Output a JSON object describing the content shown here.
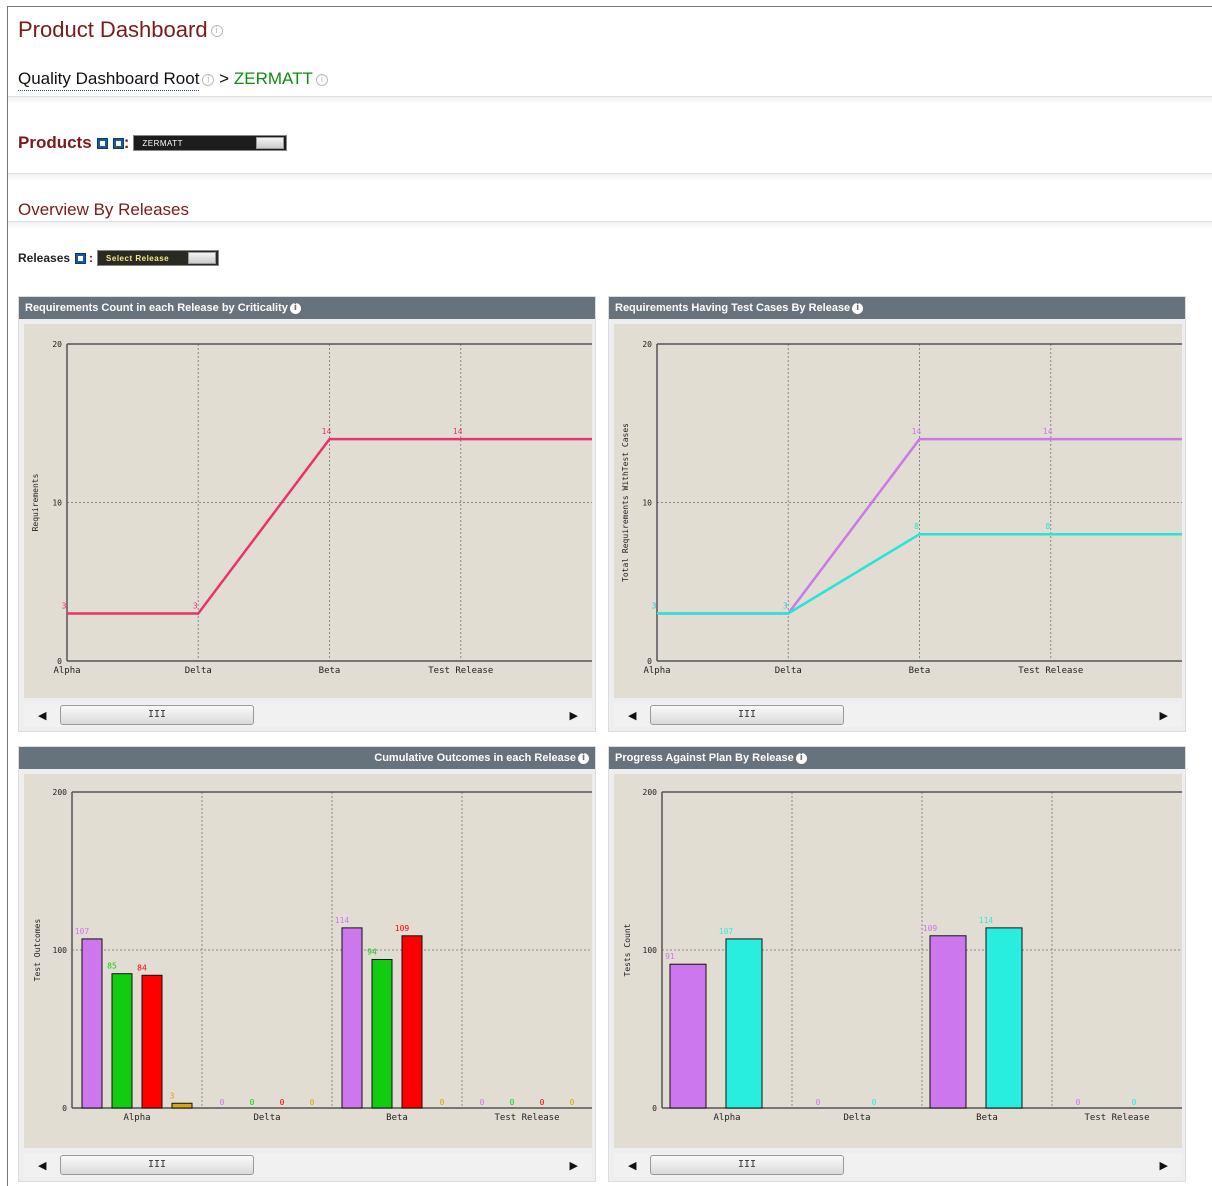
{
  "header": {
    "title": "Product Dashboard"
  },
  "breadcrumb": {
    "root": "Quality Dashboard Root",
    "separator": ">",
    "current": "ZERMATT"
  },
  "products": {
    "label": "Products",
    "colon": ":",
    "selected": "ZERMATT"
  },
  "overview": {
    "title": "Overview By Releases"
  },
  "releases": {
    "label": "Releases",
    "colon": ":",
    "select_label": "Select Release"
  },
  "scrollbar": {
    "left_arrow": "◀",
    "thumb": "III",
    "right_arrow": "▶"
  },
  "colors": {
    "brand_red": "#7a1a1a",
    "green_link": "#108a10",
    "panel_header": "#66727c",
    "plot_bg": "#e2ddd3"
  },
  "charts": [
    {
      "id": "req-criticality",
      "title": "Requirements Count in each Release by Criticality",
      "title_align": "left",
      "chart_data": {
        "type": "line",
        "categories": [
          "Alpha",
          "Delta",
          "Beta",
          "Test Release"
        ],
        "ylabel": "Requirements",
        "xlabel": "",
        "ylim": [
          0,
          20
        ],
        "yticks": [
          0,
          10,
          20
        ],
        "grid": true,
        "series": [
          {
            "values": [
              3,
              3,
              14,
              14
            ],
            "color": "#e8336b"
          }
        ]
      }
    },
    {
      "id": "req-testcases",
      "title": "Requirements Having Test Cases By Release",
      "title_align": "left",
      "chart_data": {
        "type": "line",
        "categories": [
          "Alpha",
          "Delta",
          "Beta",
          "Test Release"
        ],
        "ylabel": "Total Requirements WithTest Cases",
        "xlabel": "",
        "ylim": [
          0,
          20
        ],
        "yticks": [
          0,
          10,
          20
        ],
        "grid": true,
        "series": [
          {
            "values": [
              3,
              3,
              14,
              14
            ],
            "color": "#c77ae8"
          },
          {
            "values": [
              3,
              3,
              8,
              8
            ],
            "color": "#28e4d6"
          }
        ]
      }
    },
    {
      "id": "cumulative-outcomes",
      "title": "Cumulative Outcomes in each Release",
      "title_align": "right",
      "chart_data": {
        "type": "bar",
        "categories": [
          "Alpha",
          "Delta",
          "Beta",
          "Test Release"
        ],
        "ylabel": "Test Outcomes",
        "xlabel": "",
        "ylim": [
          0,
          200
        ],
        "yticks": [
          0,
          100,
          200
        ],
        "grid": true,
        "series": [
          {
            "values": [
              107,
              0,
              114,
              0
            ],
            "color": "#cc77ee"
          },
          {
            "values": [
              85,
              0,
              94,
              0
            ],
            "color": "#11cc11"
          },
          {
            "values": [
              84,
              0,
              109,
              0
            ],
            "color": "#ff0000"
          },
          {
            "values": [
              3,
              0,
              0,
              0
            ],
            "color": "#d4a514"
          }
        ]
      }
    },
    {
      "id": "progress-plan",
      "title": "Progress Against Plan By Release",
      "title_align": "left",
      "chart_data": {
        "type": "bar",
        "categories": [
          "Alpha",
          "Delta",
          "Beta",
          "Test Release"
        ],
        "ylabel": "Tests Count",
        "xlabel": "",
        "ylim": [
          0,
          200
        ],
        "yticks": [
          0,
          100,
          200
        ],
        "grid": true,
        "series": [
          {
            "values": [
              91,
              0,
              109,
              0
            ],
            "color": "#cc77ee"
          },
          {
            "values": [
              107,
              0,
              114,
              0
            ],
            "color": "#28eee0"
          }
        ]
      }
    }
  ]
}
